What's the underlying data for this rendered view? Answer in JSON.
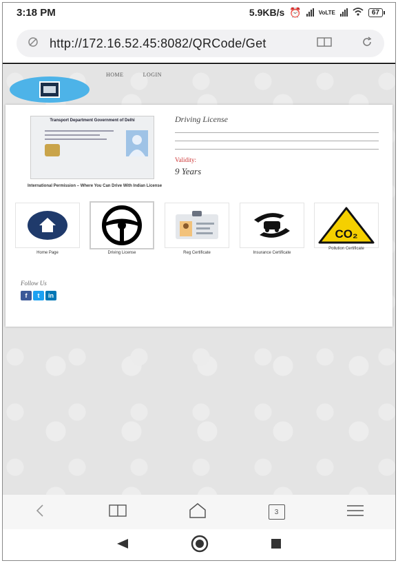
{
  "status": {
    "time": "3:18 PM",
    "speed": "5.9KB/s",
    "battery": "67"
  },
  "browser": {
    "url": "http://172.16.52.45:8082/QRCode/Get",
    "tabs_count": "3"
  },
  "nav": {
    "home": "HOME",
    "login": "LOGIN"
  },
  "license": {
    "header": "Transport Department Government of Delhi",
    "caption": "International Permission – Where You Can Drive With Indian License",
    "title": "Driving License",
    "validity_label": "Validity:",
    "validity_value": "9 Years"
  },
  "services": [
    {
      "label": "Home Page"
    },
    {
      "label": "Driving License"
    },
    {
      "label": "Reg Certificate"
    },
    {
      "label": "Insurance Certificate"
    },
    {
      "label": "Pollution Certificate"
    }
  ],
  "follow": {
    "label": "Follow Us",
    "facebook": "f",
    "twitter": "t",
    "linkedin": "in"
  },
  "colors": {
    "accent_blue": "#1f3a6b",
    "logo_blue": "#4db3e8",
    "validity_red": "#cc3333",
    "co2_yellow": "#f5d000"
  }
}
